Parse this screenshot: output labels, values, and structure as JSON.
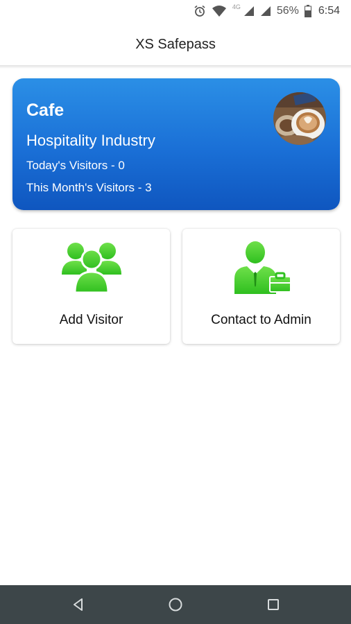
{
  "status_bar": {
    "network_label": "4G",
    "battery_percent": "56%",
    "time": "6:54",
    "icons": [
      "alarm-icon",
      "wifi-icon",
      "signal-icon",
      "signal-icon",
      "battery-icon"
    ]
  },
  "app_bar": {
    "title": "XS Safepass"
  },
  "business": {
    "name": "Cafe",
    "industry": "Hospitality Industry",
    "today_visitors": "Today's Visitors - 0",
    "month_visitors": "This Month's Visitors - 3",
    "avatar": "coffee-photo"
  },
  "actions": [
    {
      "label": "Add Visitor",
      "icon": "group-icon"
    },
    {
      "label": "Contact to Admin",
      "icon": "admin-icon"
    }
  ],
  "nav_bar": {
    "icons": [
      "back-icon",
      "home-icon",
      "recents-icon"
    ]
  },
  "colors": {
    "card_gradient_top": "#2b8fe6",
    "card_gradient_bottom": "#0f56bf",
    "icon_green": "#4cd137",
    "nav_bar": "#3d4649"
  }
}
